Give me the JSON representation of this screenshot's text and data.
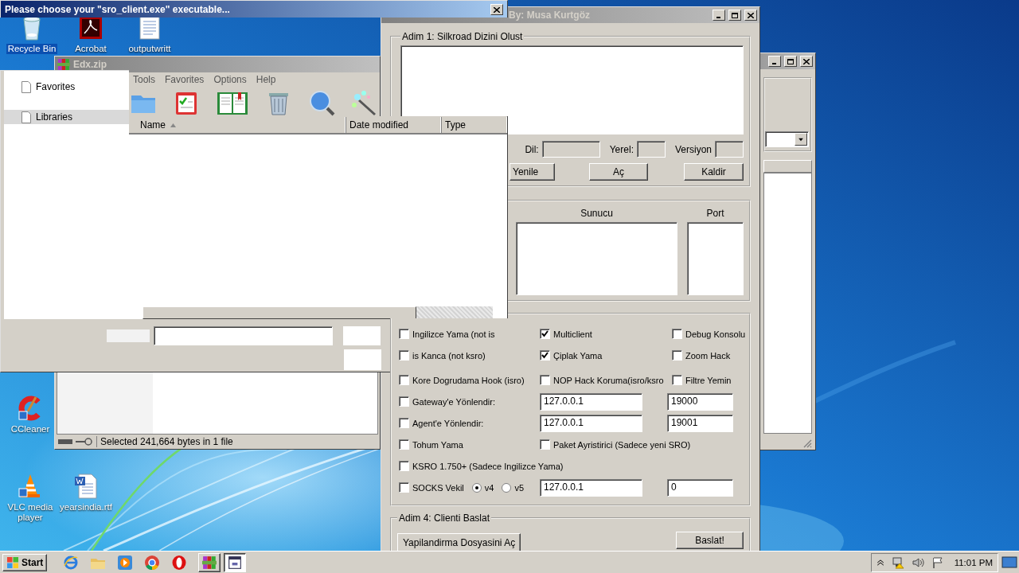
{
  "desktop": {
    "icons": [
      {
        "label": "Recycle Bin",
        "kind": "recycle",
        "selected": true
      },
      {
        "label": "Acrobat",
        "kind": "acrobat",
        "selected": false
      },
      {
        "label": "outputwritt",
        "kind": "document",
        "selected": false
      },
      {
        "label": "CCleaner",
        "kind": "ccleaner",
        "selected": false
      },
      {
        "label": "VLC media player",
        "kind": "vlc",
        "selected": false
      },
      {
        "label": "yearsindia.rtf",
        "kind": "word",
        "selected": false
      }
    ]
  },
  "main_window": {
    "title": "By: Musa Kurtgöz",
    "step1": {
      "legend": "Adim 1: Silkroad Dizini Olust",
      "field_labels": [
        "Dil:",
        "Yerel:",
        "Versiyon"
      ],
      "buttons": [
        "Yenile",
        "Aç",
        "Kaldir"
      ]
    },
    "step2": {
      "columns": [
        "Sunucu",
        "Port"
      ]
    },
    "step3": {
      "rows": [
        [
          [
            {
              "kind": "checkbox",
              "label": "Ingilizce Yama (not is",
              "checked": false
            }
          ],
          [
            {
              "kind": "checkbox",
              "label": "Multiclient",
              "checked": true
            }
          ],
          [
            {
              "kind": "checkbox",
              "label": "Debug Konsolu",
              "checked": false
            }
          ]
        ],
        [
          [
            {
              "kind": "checkbox",
              "label": "is Kanca (not ksro)",
              "checked": false
            }
          ],
          [
            {
              "kind": "checkbox",
              "label": "Çiplak Yama",
              "checked": true
            }
          ],
          [
            {
              "kind": "checkbox",
              "label": "Zoom Hack",
              "checked": false
            }
          ]
        ],
        [
          [
            {
              "kind": "checkbox",
              "label": "Kore Dogrudama Hook (isro)",
              "checked": false
            }
          ],
          [
            {
              "kind": "checkbox",
              "label": "NOP Hack Koruma(isro/ksro",
              "checked": false
            }
          ],
          [
            {
              "kind": "checkbox",
              "label": "Filtre Yemin",
              "checked": false
            }
          ]
        ],
        [
          [
            {
              "kind": "checkbox",
              "label": "Gateway'e Yönlendir:",
              "checked": false
            }
          ],
          [
            {
              "kind": "field",
              "value": "127.0.0.1"
            }
          ],
          [
            {
              "kind": "field",
              "value": "19000"
            }
          ]
        ],
        [
          [
            {
              "kind": "checkbox",
              "label": "Agent'e Yönlendir:",
              "checked": false
            }
          ],
          [
            {
              "kind": "field",
              "value": "127.0.0.1"
            }
          ],
          [
            {
              "kind": "field",
              "value": "19001"
            }
          ]
        ],
        [
          [
            {
              "kind": "checkbox",
              "label": "Tohum Yama",
              "checked": false
            }
          ],
          [
            {
              "kind": "checkbox",
              "label": "Paket Ayristirici (Sadece yeni SRO)",
              "checked": false
            }
          ]
        ],
        [
          [
            {
              "kind": "checkbox",
              "label": "KSRO 1.750+ (Sadece Ingilizce Yama)",
              "checked": false
            }
          ]
        ],
        [
          [
            {
              "kind": "checkbox",
              "label": "SOCKS Vekil",
              "checked": false
            },
            {
              "kind": "radio",
              "label": "v4",
              "selected": true
            },
            {
              "kind": "radio",
              "label": "v5",
              "selected": false
            }
          ],
          [
            {
              "kind": "field",
              "value": "127.0.0.1"
            }
          ],
          [
            {
              "kind": "field",
              "value": "0"
            }
          ]
        ]
      ]
    },
    "step4": {
      "legend": "Adim 4: Clienti Baslat",
      "buttons": [
        "Yapilandirma Dosyasini Aç",
        "Baslat!"
      ]
    }
  },
  "archive_window": {
    "title": "Edx.zip",
    "menu": [
      "Tools",
      "Favorites",
      "Options",
      "Help"
    ],
    "status": "Selected 241,664 bytes in 1 file"
  },
  "file_dialog": {
    "title": "Please choose your \"sro_client.exe\" executable...",
    "nav": [
      {
        "label": "Favorites",
        "selected": false
      },
      {
        "label": "Libraries",
        "selected": true
      }
    ],
    "columns": [
      {
        "label": "Name",
        "sorted": true
      },
      {
        "label": "Date modified",
        "sorted": false
      },
      {
        "label": "Type",
        "sorted": false
      }
    ]
  },
  "taskbar": {
    "start": "Start",
    "tasks": [
      {
        "kind": "winrar",
        "selected": false
      },
      {
        "kind": "app",
        "selected": true
      }
    ],
    "clock": "11:01 PM"
  }
}
